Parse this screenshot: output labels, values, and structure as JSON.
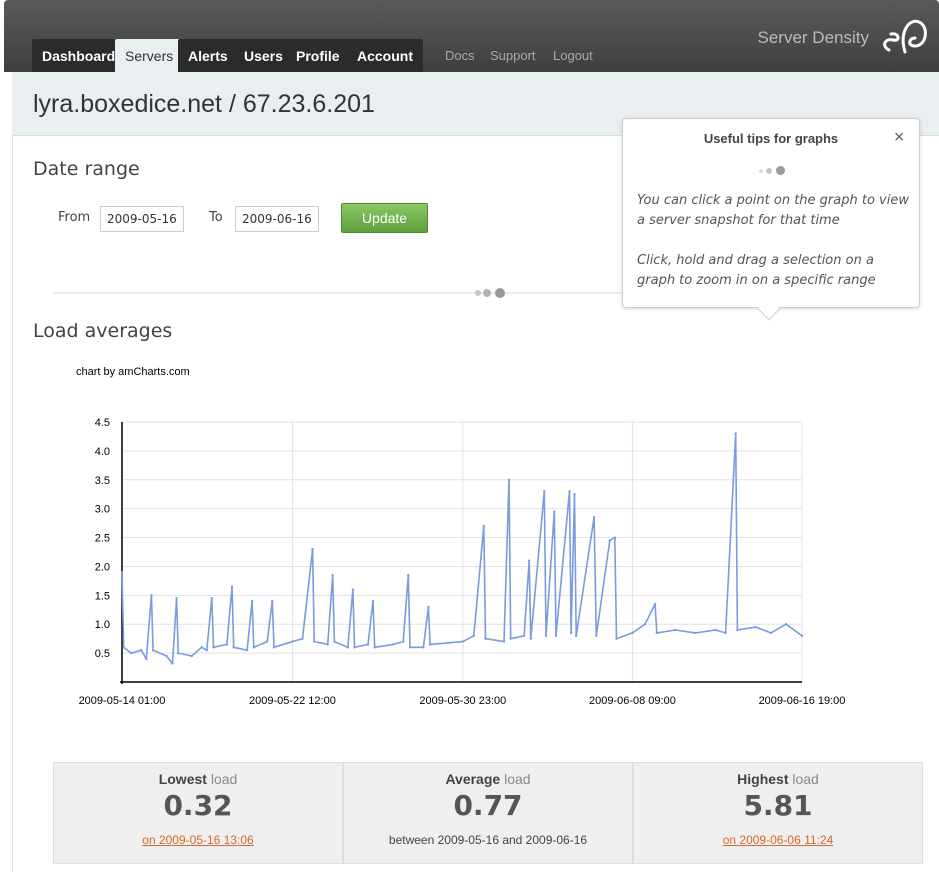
{
  "nav": {
    "tabs": [
      {
        "label": "Dashboard",
        "active": false
      },
      {
        "label": "Servers",
        "active": true
      },
      {
        "label": "Alerts",
        "active": false
      },
      {
        "label": "Users",
        "active": false
      },
      {
        "label": "Profile",
        "active": false
      },
      {
        "label": "Account",
        "active": false
      }
    ],
    "secondary": [
      "Docs",
      "Support",
      "Logout"
    ],
    "brand": "Server Density"
  },
  "host": {
    "title": "lyra.boxedice.net / 67.23.6.201"
  },
  "date_range": {
    "heading": "Date range",
    "from_label": "From",
    "from_value": "2009-05-16",
    "to_label": "To",
    "to_value": "2009-06-16",
    "update_label": "Update"
  },
  "tips": {
    "title": "Useful tips for graphs",
    "close": "×",
    "tip1": "You can click a point on the graph to view a server snapshot for that time",
    "tip2": "Click, hold and drag a selection on a graph to zoom in on a specific range"
  },
  "load": {
    "heading": "Load averages",
    "credit": "chart by amCharts.com"
  },
  "chart_data": {
    "type": "line",
    "title": "",
    "xlabel": "",
    "ylabel": "",
    "ylim": [
      0,
      4.5
    ],
    "yticks": [
      "0.5",
      "1.0",
      "1.5",
      "2.0",
      "2.5",
      "3.0",
      "3.5",
      "4.0",
      "4.5"
    ],
    "xticks": [
      "2009-05-14 01:00",
      "2009-05-22 12:00",
      "2009-05-30 23:00",
      "2009-06-08 09:00",
      "2009-06-16 19:00"
    ],
    "x_range": [
      "2009-05-14 01:00",
      "2009-06-16 19:00"
    ],
    "grid": true,
    "color": "#7b9be0",
    "series": [
      {
        "points": [
          [
            "2009-05-14 01:00",
            1.9
          ],
          [
            "2009-05-14 03:00",
            0.6
          ],
          [
            "2009-05-14 12:00",
            0.5
          ],
          [
            "2009-05-15 00:00",
            0.55
          ],
          [
            "2009-05-15 06:00",
            0.4
          ],
          [
            "2009-05-15 12:00",
            1.5
          ],
          [
            "2009-05-15 14:00",
            0.55
          ],
          [
            "2009-05-16 06:00",
            0.45
          ],
          [
            "2009-05-16 13:06",
            0.32
          ],
          [
            "2009-05-16 18:00",
            1.45
          ],
          [
            "2009-05-16 20:00",
            0.5
          ],
          [
            "2009-05-17 12:00",
            0.45
          ],
          [
            "2009-05-18 00:00",
            0.6
          ],
          [
            "2009-05-18 06:00",
            0.55
          ],
          [
            "2009-05-18 12:00",
            1.45
          ],
          [
            "2009-05-18 14:00",
            0.6
          ],
          [
            "2009-05-19 06:00",
            0.65
          ],
          [
            "2009-05-19 12:00",
            1.65
          ],
          [
            "2009-05-19 14:00",
            0.6
          ],
          [
            "2009-05-20 06:00",
            0.55
          ],
          [
            "2009-05-20 12:00",
            1.4
          ],
          [
            "2009-05-20 14:00",
            0.6
          ],
          [
            "2009-05-21 06:00",
            0.7
          ],
          [
            "2009-05-21 12:00",
            1.4
          ],
          [
            "2009-05-21 14:00",
            0.6
          ],
          [
            "2009-05-22 12:00",
            0.7
          ],
          [
            "2009-05-23 00:00",
            0.75
          ],
          [
            "2009-05-23 12:00",
            2.3
          ],
          [
            "2009-05-23 14:00",
            0.7
          ],
          [
            "2009-05-24 06:00",
            0.65
          ],
          [
            "2009-05-24 12:00",
            1.85
          ],
          [
            "2009-05-24 14:00",
            0.7
          ],
          [
            "2009-05-25 06:00",
            0.6
          ],
          [
            "2009-05-25 12:00",
            1.6
          ],
          [
            "2009-05-25 14:00",
            0.6
          ],
          [
            "2009-05-26 06:00",
            0.65
          ],
          [
            "2009-05-26 12:00",
            1.4
          ],
          [
            "2009-05-26 14:00",
            0.6
          ],
          [
            "2009-05-27 12:00",
            0.65
          ],
          [
            "2009-05-28 00:00",
            0.7
          ],
          [
            "2009-05-28 06:00",
            1.85
          ],
          [
            "2009-05-28 08:00",
            0.6
          ],
          [
            "2009-05-29 00:00",
            0.6
          ],
          [
            "2009-05-29 06:00",
            1.3
          ],
          [
            "2009-05-29 08:00",
            0.65
          ],
          [
            "2009-05-30 23:00",
            0.7
          ],
          [
            "2009-05-31 12:00",
            0.8
          ],
          [
            "2009-06-01 00:00",
            2.7
          ],
          [
            "2009-06-01 02:00",
            0.75
          ],
          [
            "2009-06-02 00:00",
            0.7
          ],
          [
            "2009-06-02 06:00",
            3.5
          ],
          [
            "2009-06-02 08:00",
            0.75
          ],
          [
            "2009-06-03 00:00",
            0.8
          ],
          [
            "2009-06-03 06:00",
            2.1
          ],
          [
            "2009-06-03 08:00",
            0.75
          ],
          [
            "2009-06-04 00:00",
            3.3
          ],
          [
            "2009-06-04 02:00",
            0.8
          ],
          [
            "2009-06-04 12:00",
            2.95
          ],
          [
            "2009-06-04 14:00",
            0.8
          ],
          [
            "2009-06-05 06:00",
            3.3
          ],
          [
            "2009-06-05 08:00",
            0.85
          ],
          [
            "2009-06-05 12:00",
            3.25
          ],
          [
            "2009-06-05 14:00",
            0.8
          ],
          [
            "2009-06-06 11:24",
            2.85
          ],
          [
            "2009-06-06 14:00",
            0.8
          ],
          [
            "2009-06-07 06:00",
            2.45
          ],
          [
            "2009-06-07 12:00",
            2.5
          ],
          [
            "2009-06-07 14:00",
            0.75
          ],
          [
            "2009-06-08 09:00",
            0.85
          ],
          [
            "2009-06-09 00:00",
            1.0
          ],
          [
            "2009-06-09 12:00",
            1.35
          ],
          [
            "2009-06-09 14:00",
            0.85
          ],
          [
            "2009-06-10 12:00",
            0.9
          ],
          [
            "2009-06-11 12:00",
            0.85
          ],
          [
            "2009-06-12 12:00",
            0.9
          ],
          [
            "2009-06-13 00:00",
            0.85
          ],
          [
            "2009-06-13 12:00",
            4.3
          ],
          [
            "2009-06-13 14:00",
            0.9
          ],
          [
            "2009-06-14 12:00",
            0.95
          ],
          [
            "2009-06-15 06:00",
            0.85
          ],
          [
            "2009-06-16 00:00",
            1.0
          ],
          [
            "2009-06-16 19:00",
            0.8
          ]
        ]
      }
    ]
  },
  "stats": [
    {
      "label_bold": "Lowest",
      "label_rest": " load",
      "value": "0.32",
      "sub": "on 2009-05-16 13:06",
      "link": true
    },
    {
      "label_bold": "Average",
      "label_rest": " load",
      "value": "0.77",
      "sub": "between 2009-05-16 and 2009-06-16",
      "link": false
    },
    {
      "label_bold": "Highest",
      "label_rest": " load",
      "value": "5.81",
      "sub": "on 2009-06-06 11:24",
      "link": true
    }
  ]
}
